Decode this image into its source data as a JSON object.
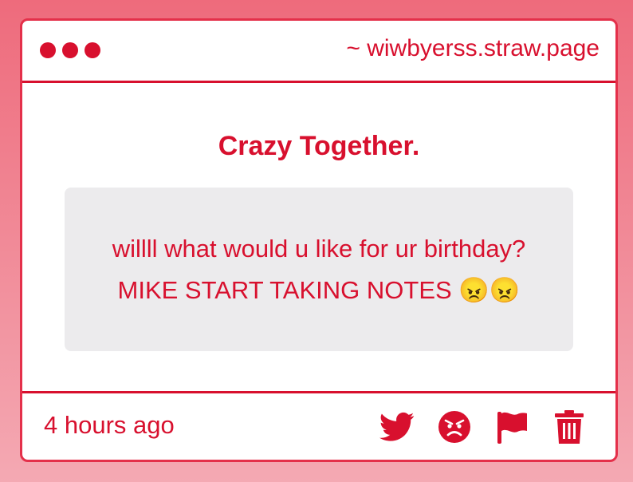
{
  "window": {
    "url": "~ wiwbyerss.straw.page"
  },
  "post": {
    "title": "Crazy Together.",
    "message": "willll what would u like for ur birthday? MIKE START TAKING NOTES 😠😠",
    "timestamp": "4 hours ago"
  },
  "actions": [
    {
      "icon": "twitter-bird-icon",
      "label": "share on twitter"
    },
    {
      "icon": "angry-face-icon",
      "label": "react"
    },
    {
      "icon": "flag-icon",
      "label": "report"
    },
    {
      "icon": "trash-icon",
      "label": "delete"
    }
  ],
  "colors": {
    "accent": "#d8102e",
    "background_top": "#ee6b7c",
    "background_bottom": "#f4a9b3",
    "message_bg": "#ecebed"
  }
}
